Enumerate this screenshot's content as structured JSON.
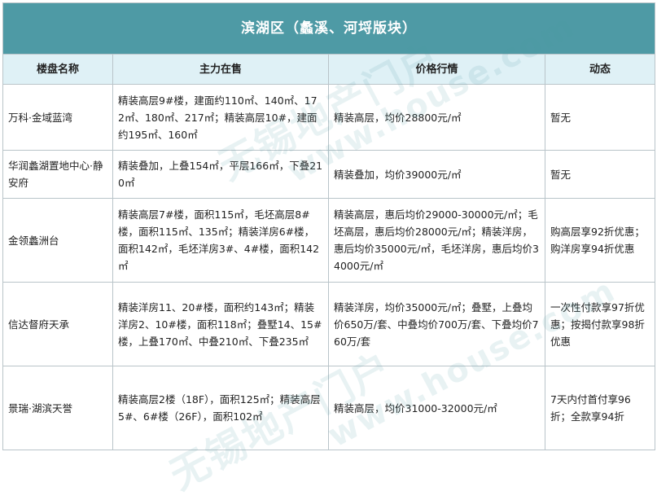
{
  "table": {
    "title": "滨湖区（蠡溪、河埒版块）",
    "headers": [
      "楼盘名称",
      "主力在售",
      "价格行情",
      "动态"
    ],
    "rows": [
      {
        "name": "万科·金域蓝湾",
        "supply": "精装高层9#楼，建面约110㎡、140㎡、172㎡、180㎡、217㎡；精装高层10#，建面约195㎡、160㎡",
        "price": "精装高层，均价28800元/㎡",
        "news": "暂无"
      },
      {
        "name": "华润蠡湖置地中心·静安府",
        "supply": "精装叠加，上叠154㎡，平层166㎡，下叠210㎡",
        "price": "精装叠加，均价39000元/㎡",
        "news": "暂无"
      },
      {
        "name": "金领蠡洲台",
        "supply": "精装高层7#楼，面积115㎡，毛坯高层8#楼，面积115㎡、135㎡；精装洋房6#楼，面积142㎡，毛坯洋房3#、4#楼，面积142㎡",
        "price": "精装高层，惠后均价29000-30000元/㎡；毛坯高层，惠后均价28000元/㎡；精装洋房，惠后均价35000元/㎡，毛坯洋房，惠后均价34000元/㎡",
        "news": "购高层享92折优惠；购洋房享94折优惠"
      },
      {
        "name": "信达督府天承",
        "supply": "精装洋房11、20#楼，面积约143㎡；精装洋房2、10#楼，面积118㎡；叠墅14、15#楼，上叠170㎡、中叠210㎡、下叠235㎡",
        "price": "精装洋房，均价35000元/㎡；叠墅，上叠均价650万/套、中叠均价700万/套、下叠均价760万/套",
        "news": "一次性付款享97折优惠；按揭付款享98折优惠"
      },
      {
        "name": "景瑞·湖滨天誉",
        "supply": "精装高层2楼（18F），面积125㎡；精装高层5#、6#楼（26F），面积102㎡",
        "price": "精装高层，均价31000-32000元/㎡",
        "news": "7天内付首付享96折；全款享94折"
      }
    ]
  },
  "watermarks": [
    "无锡地产门户",
    "www.house.com",
    "无锡地产门户",
    "www.house.com"
  ],
  "colors": {
    "title_bg": "#4e9aa5",
    "header_bg": "#dff1f6",
    "border": "#b9c4c9"
  }
}
